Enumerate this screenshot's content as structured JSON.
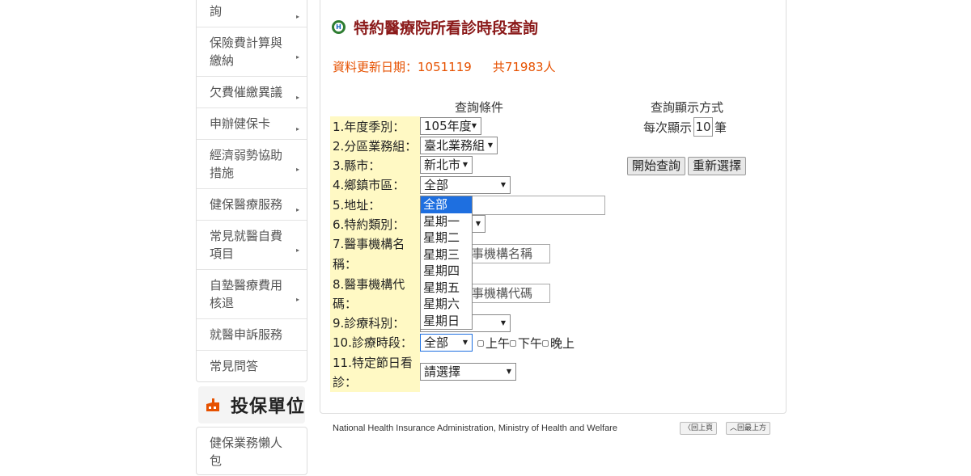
{
  "sidebar": {
    "items": [
      {
        "label": "詢"
      },
      {
        "label": "保險費計算與繳納"
      },
      {
        "label": "欠費催繳異議"
      },
      {
        "label": "申辦健保卡"
      },
      {
        "label": "經濟弱勢協助措施"
      },
      {
        "label": "健保醫療服務"
      },
      {
        "label": "常見就醫自費項目"
      },
      {
        "label": "自墊醫療費用核退"
      },
      {
        "label": "就醫申訴服務"
      },
      {
        "label": "常見問答"
      }
    ],
    "arrow": "▸",
    "section_title": "投保單位",
    "section_items": [
      {
        "label": "健保業務懶人包"
      }
    ]
  },
  "page": {
    "title": "特約醫療院所看診時段查詢",
    "logo_letter": "H",
    "update_date": "資料更新日期：1051119",
    "total": "共71983人"
  },
  "query": {
    "conditions_header": "查詢條件",
    "display_header": "查詢顯示方式",
    "per_page_prefix": "每次顯示",
    "per_page_value": "10",
    "per_page_suffix": "筆",
    "search_button": "開始查詢",
    "reset_button": "重新選擇",
    "fields": {
      "year": {
        "label": "1.年度季別：",
        "value": "105年度"
      },
      "district": {
        "label": "2.分區業務組：",
        "value": "臺北業務組"
      },
      "city": {
        "label": "3.縣市：",
        "value": "新北市"
      },
      "town": {
        "label": "4.鄉鎮市區：",
        "value": "全部"
      },
      "address": {
        "label": "5.地址："
      },
      "type": {
        "label": "6.特約類別："
      },
      "org_name": {
        "label_1": "7.醫事機構名",
        "label_2": "稱：",
        "placeholder": "事機構名稱"
      },
      "org_code": {
        "label_1": "8.醫事機構代",
        "label_2": "碼：",
        "placeholder": "事機構代碼"
      },
      "dept": {
        "label": "9.診療科別："
      },
      "session": {
        "label": "10.診療時段：",
        "value": "全部",
        "opt_am": "上午",
        "opt_pm": "下午",
        "opt_night": "晚上"
      },
      "holiday": {
        "label_1": "11.特定節日看",
        "label_2": "診：",
        "value": "請選擇"
      }
    },
    "dropdown_options": [
      "全部",
      "星期一",
      "星期二",
      "星期三",
      "星期四",
      "星期五",
      "星期六",
      "星期日"
    ],
    "dropdown_selected": "全部"
  },
  "footer": {
    "text": "National Health Insurance Administration, Ministry of Health and Welfare",
    "back_button": "〈回上頁",
    "top_button": "︿回最上方"
  },
  "colors": {
    "title": "#8b1a1a",
    "update": "#e65100",
    "label_bg": "#fff9c4",
    "highlight": "#1e6fe0",
    "section_icon": "#e65100"
  }
}
